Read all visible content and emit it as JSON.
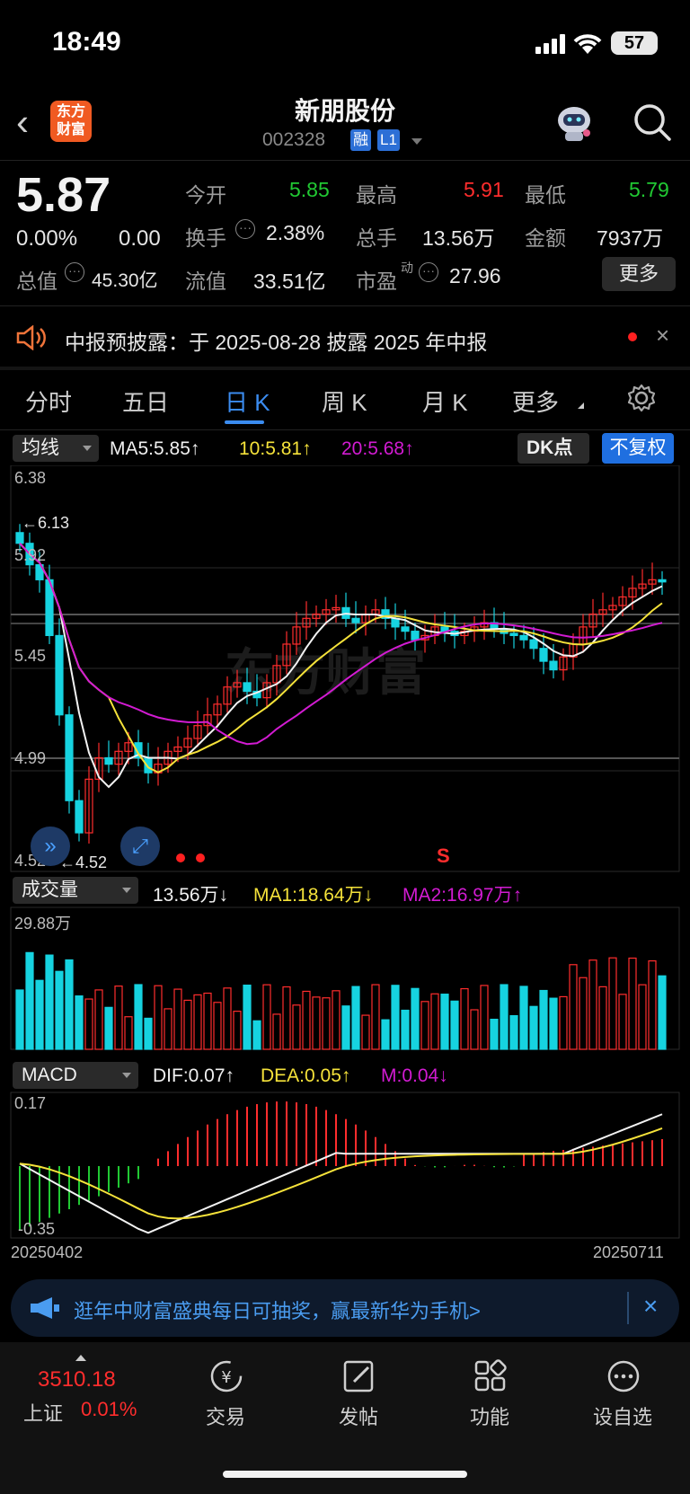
{
  "status_bar": {
    "time": "18:49",
    "battery": "57"
  },
  "nav": {
    "logo_text": "东方财富",
    "title": "新朋股份",
    "code": "002328",
    "tag_margin": "融",
    "tag_level": "L1"
  },
  "quote": {
    "price": "5.87",
    "change_pct": "0.00%",
    "change_amt": "0.00",
    "open_label": "今开",
    "open": "5.85",
    "high_label": "最高",
    "high": "5.91",
    "low_label": "最低",
    "low": "5.79",
    "turnover_label": "换手",
    "turnover": "2.38%",
    "volume_label": "总手",
    "volume": "13.56万",
    "amount_label": "金额",
    "amount": "7937万",
    "mktcap_label": "总值",
    "mktcap": "45.30亿",
    "float_label": "流值",
    "float": "33.51亿",
    "pe_label": "市盈",
    "pe_sup": "动",
    "pe": "27.96",
    "more_label": "更多"
  },
  "notice": {
    "text": "中报预披露：于 2025-08-28 披露 2025 年中报"
  },
  "tabs": [
    {
      "label": "分时"
    },
    {
      "label": "五日"
    },
    {
      "label": "日 K"
    },
    {
      "label": "周 K"
    },
    {
      "label": "月 K"
    },
    {
      "label": "更多"
    }
  ],
  "kline": {
    "indicator": "均线",
    "ma5": "MA5:5.85↑",
    "ma10": "10:5.81↑",
    "ma20": "20:5.68↑",
    "dk_label": "DK点",
    "adjust_label": "不复权",
    "y_labels": [
      "6.38",
      "5.92",
      "5.45",
      "4.99",
      "4.52"
    ],
    "max_marker": "←6.13",
    "min_marker": "←4.52",
    "signal": "S",
    "watermark": "东方财富"
  },
  "volume_panel": {
    "indicator": "成交量",
    "vol": "13.56万↓",
    "ma1": "MA1:18.64万↓",
    "ma2": "MA2:16.97万↑",
    "y_max": "29.88万"
  },
  "macd_panel": {
    "indicator": "MACD",
    "dif": "DIF:0.07↑",
    "dea": "DEA:0.05↑",
    "m": "M:0.04↓",
    "y_max": "0.17",
    "y_min": "-0.35",
    "date_start": "20250402",
    "date_end": "20250711"
  },
  "banner": {
    "text": "逛年中财富盛典每日可抽奖，赢最新华为手机>"
  },
  "bottom_nav": {
    "index_value": "3510.18",
    "index_name": "上证",
    "index_change": "0.01%",
    "items": [
      {
        "label": "交易"
      },
      {
        "label": "发帖"
      },
      {
        "label": "功能"
      },
      {
        "label": "设自选"
      }
    ]
  },
  "colors": {
    "up": "#ff2d2d",
    "down": "#21c933",
    "accent": "#3b8cf0",
    "cyan": "#16d3e0",
    "ma10": "#f5e23a",
    "ma20": "#d21bd2"
  }
}
